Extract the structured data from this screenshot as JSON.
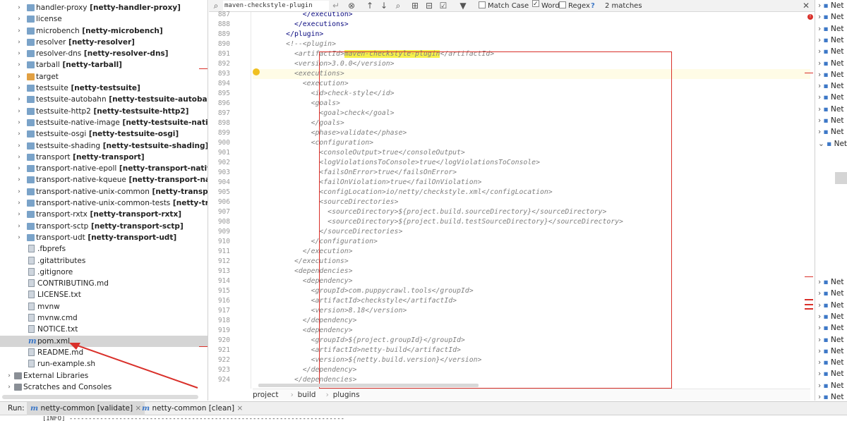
{
  "project_tree": {
    "items": [
      {
        "chevron": true,
        "icon": "folder",
        "name": "handler-proxy",
        "module": "[netty-handler-proxy]"
      },
      {
        "chevron": true,
        "icon": "folder",
        "name": "license",
        "module": ""
      },
      {
        "chevron": true,
        "icon": "folder",
        "name": "microbench",
        "module": "[netty-microbench]"
      },
      {
        "chevron": true,
        "icon": "folder",
        "name": "resolver",
        "module": "[netty-resolver]"
      },
      {
        "chevron": true,
        "icon": "folder",
        "name": "resolver-dns",
        "module": "[netty-resolver-dns]"
      },
      {
        "chevron": true,
        "icon": "folder",
        "name": "tarball",
        "module": "[netty-tarball]"
      },
      {
        "chevron": true,
        "icon": "folder-orange",
        "name": "target",
        "module": ""
      },
      {
        "chevron": true,
        "icon": "folder",
        "name": "testsuite",
        "module": "[netty-testsuite]"
      },
      {
        "chevron": true,
        "icon": "folder",
        "name": "testsuite-autobahn",
        "module": "[netty-testsuite-autobahn]"
      },
      {
        "chevron": true,
        "icon": "folder",
        "name": "testsuite-http2",
        "module": "[netty-testsuite-http2]"
      },
      {
        "chevron": true,
        "icon": "folder",
        "name": "testsuite-native-image",
        "module": "[netty-testsuite-native-image"
      },
      {
        "chevron": true,
        "icon": "folder",
        "name": "testsuite-osgi",
        "module": "[netty-testsuite-osgi]"
      },
      {
        "chevron": true,
        "icon": "folder",
        "name": "testsuite-shading",
        "module": "[netty-testsuite-shading]"
      },
      {
        "chevron": true,
        "icon": "folder",
        "name": "transport",
        "module": "[netty-transport]"
      },
      {
        "chevron": true,
        "icon": "folder",
        "name": "transport-native-epoll",
        "module": "[netty-transport-native-epoll"
      },
      {
        "chevron": true,
        "icon": "folder",
        "name": "transport-native-kqueue",
        "module": "[netty-transport-native-kq"
      },
      {
        "chevron": true,
        "icon": "folder",
        "name": "transport-native-unix-common",
        "module": "[netty-transport-nati"
      },
      {
        "chevron": true,
        "icon": "folder",
        "name": "transport-native-unix-common-tests",
        "module": "[netty-transport"
      },
      {
        "chevron": true,
        "icon": "folder",
        "name": "transport-rxtx",
        "module": "[netty-transport-rxtx]"
      },
      {
        "chevron": true,
        "icon": "folder",
        "name": "transport-sctp",
        "module": "[netty-transport-sctp]"
      },
      {
        "chevron": true,
        "icon": "folder",
        "name": "transport-udt",
        "module": "[netty-transport-udt]"
      },
      {
        "chevron": false,
        "icon": "file",
        "name": ".fbprefs",
        "module": ""
      },
      {
        "chevron": false,
        "icon": "file",
        "name": ".gitattributes",
        "module": ""
      },
      {
        "chevron": false,
        "icon": "file",
        "name": ".gitignore",
        "module": ""
      },
      {
        "chevron": false,
        "icon": "file",
        "name": "CONTRIBUTING.md",
        "module": ""
      },
      {
        "chevron": false,
        "icon": "file",
        "name": "LICENSE.txt",
        "module": ""
      },
      {
        "chevron": false,
        "icon": "file",
        "name": "mvnw",
        "module": ""
      },
      {
        "chevron": false,
        "icon": "file",
        "name": "mvnw.cmd",
        "module": ""
      },
      {
        "chevron": false,
        "icon": "file",
        "name": "NOTICE.txt",
        "module": ""
      },
      {
        "chevron": false,
        "icon": "maven",
        "name": "pom.xml",
        "module": "",
        "selected": true
      },
      {
        "chevron": false,
        "icon": "file",
        "name": "README.md",
        "module": ""
      },
      {
        "chevron": false,
        "icon": "file",
        "name": "run-example.sh",
        "module": ""
      },
      {
        "chevron": true,
        "icon": "library",
        "name": "External Libraries",
        "module": "",
        "root": true
      },
      {
        "chevron": true,
        "icon": "scratch",
        "name": "Scratches and Consoles",
        "module": "",
        "root": true
      }
    ]
  },
  "search": {
    "query": "maven-checkstyle-plugin",
    "match_case_label": "Match Case",
    "match_case": false,
    "words_label": "Words",
    "words": true,
    "regex_label": "Regex",
    "regex": false,
    "help": "?",
    "matches": "2 matches"
  },
  "editor": {
    "lines": [
      {
        "n": "887",
        "text": "            </execution>",
        "kind": "code"
      },
      {
        "n": "888",
        "text": "          </executions>",
        "kind": "code"
      },
      {
        "n": "889",
        "text": "        </plugin>",
        "kind": "code"
      },
      {
        "n": "890",
        "text": "        <!--<plugin>",
        "kind": "cmt"
      },
      {
        "n": "891",
        "text": "          <artifactId>maven-checkstyle-plugin</artifactId>",
        "kind": "cmt",
        "hl": "maven-checkstyle-plugin"
      },
      {
        "n": "892",
        "text": "          <version>3.0.0</version>",
        "kind": "cmt"
      },
      {
        "n": "893",
        "text": "          <executions>",
        "kind": "cmt",
        "cur": true
      },
      {
        "n": "894",
        "text": "            <execution>",
        "kind": "cmt"
      },
      {
        "n": "895",
        "text": "              <id>check-style</id>",
        "kind": "cmt"
      },
      {
        "n": "896",
        "text": "              <goals>",
        "kind": "cmt"
      },
      {
        "n": "897",
        "text": "                <goal>check</goal>",
        "kind": "cmt"
      },
      {
        "n": "898",
        "text": "              </goals>",
        "kind": "cmt"
      },
      {
        "n": "899",
        "text": "              <phase>validate</phase>",
        "kind": "cmt"
      },
      {
        "n": "900",
        "text": "              <configuration>",
        "kind": "cmt"
      },
      {
        "n": "901",
        "text": "                <consoleOutput>true</consoleOutput>",
        "kind": "cmt"
      },
      {
        "n": "902",
        "text": "                <logViolationsToConsole>true</logViolationsToConsole>",
        "kind": "cmt"
      },
      {
        "n": "903",
        "text": "                <failsOnError>true</failsOnError>",
        "kind": "cmt"
      },
      {
        "n": "904",
        "text": "                <failOnViolation>true</failOnViolation>",
        "kind": "cmt"
      },
      {
        "n": "905",
        "text": "                <configLocation>io/netty/checkstyle.xml</configLocation>",
        "kind": "cmt"
      },
      {
        "n": "906",
        "text": "                <sourceDirectories>",
        "kind": "cmt"
      },
      {
        "n": "907",
        "text": "                  <sourceDirectory>${project.build.sourceDirectory}</sourceDirectory>",
        "kind": "cmt"
      },
      {
        "n": "908",
        "text": "                  <sourceDirectory>${project.build.testSourceDirectory}</sourceDirectory>",
        "kind": "cmt"
      },
      {
        "n": "909",
        "text": "                </sourceDirectories>",
        "kind": "cmt"
      },
      {
        "n": "910",
        "text": "              </configuration>",
        "kind": "cmt"
      },
      {
        "n": "911",
        "text": "            </execution>",
        "kind": "cmt"
      },
      {
        "n": "912",
        "text": "          </executions>",
        "kind": "cmt"
      },
      {
        "n": "913",
        "text": "          <dependencies>",
        "kind": "cmt"
      },
      {
        "n": "914",
        "text": "            <dependency>",
        "kind": "cmt"
      },
      {
        "n": "915",
        "text": "              <groupId>com.puppycrawl.tools</groupId>",
        "kind": "cmt"
      },
      {
        "n": "916",
        "text": "              <artifactId>checkstyle</artifactId>",
        "kind": "cmt"
      },
      {
        "n": "917",
        "text": "              <version>8.18</version>",
        "kind": "cmt"
      },
      {
        "n": "918",
        "text": "            </dependency>",
        "kind": "cmt"
      },
      {
        "n": "919",
        "text": "            <dependency>",
        "kind": "cmt"
      },
      {
        "n": "920",
        "text": "              <groupId>${project.groupId}</groupId>",
        "kind": "cmt"
      },
      {
        "n": "921",
        "text": "              <artifactId>netty-build</artifactId>",
        "kind": "cmt"
      },
      {
        "n": "922",
        "text": "              <version>${netty.build.version}</version>",
        "kind": "cmt"
      },
      {
        "n": "923",
        "text": "            </dependency>",
        "kind": "cmt"
      },
      {
        "n": "924",
        "text": "          </dependencies>",
        "kind": "cmt"
      }
    ],
    "breadcrumb": [
      "project",
      "build",
      "plugins"
    ]
  },
  "right_panel": {
    "items": [
      {
        "chevron": "›",
        "label": "Net"
      },
      {
        "chevron": "›",
        "label": "Net"
      },
      {
        "chevron": "›",
        "label": "Net"
      },
      {
        "chevron": "›",
        "label": "Net"
      },
      {
        "chevron": "›",
        "label": "Net"
      },
      {
        "chevron": "›",
        "label": "Net"
      },
      {
        "chevron": "›",
        "label": "Net"
      },
      {
        "chevron": "›",
        "label": "Net"
      },
      {
        "chevron": "›",
        "label": "Net"
      },
      {
        "chevron": "›",
        "label": "Net"
      },
      {
        "chevron": "›",
        "label": "Net"
      },
      {
        "chevron": "›",
        "label": "Net"
      },
      {
        "chevron": "⌄",
        "label": "Net"
      }
    ],
    "lower_items": [
      {
        "chevron": "›",
        "label": "Net"
      },
      {
        "chevron": "›",
        "label": "Net"
      },
      {
        "chevron": "›",
        "label": "Net"
      },
      {
        "chevron": "›",
        "label": "Net"
      },
      {
        "chevron": "›",
        "label": "Net"
      },
      {
        "chevron": "›",
        "label": "Net"
      },
      {
        "chevron": "›",
        "label": "Net"
      },
      {
        "chevron": "›",
        "label": "Net"
      },
      {
        "chevron": "›",
        "label": "Net"
      },
      {
        "chevron": "›",
        "label": "Net"
      },
      {
        "chevron": "›",
        "label": "Net"
      }
    ]
  },
  "run_bar": {
    "label": "Run:",
    "tabs": [
      {
        "label": "netty-common [validate]",
        "close": "×",
        "active": true
      },
      {
        "label": "netty-common [clean]",
        "close": "×",
        "active": false
      }
    ],
    "console_text": "[INFO] ------------------------------------------------------------------------"
  },
  "colors": {
    "annotation_red": "#d9302a",
    "search_highlight": "#f5f04a",
    "comment_gray": "#808080",
    "tag_blue": "#0b0b80"
  }
}
